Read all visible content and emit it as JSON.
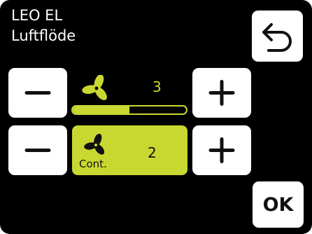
{
  "header": {
    "device": "LEO EL",
    "screen": "Luftflöde"
  },
  "fan_speed": {
    "level": "3",
    "bar_fraction": 0.5,
    "icon": "fan-icon"
  },
  "continuous": {
    "level": "2",
    "label": "Cont.",
    "icon": "fan-icon"
  },
  "buttons": {
    "back_icon": "back-arrow-icon",
    "minus_icon": "minus-icon",
    "plus_icon": "plus-icon",
    "ok_label": "OK"
  },
  "colors": {
    "background": "#000000",
    "accent": "#c9d831",
    "button": "#ffffff"
  }
}
